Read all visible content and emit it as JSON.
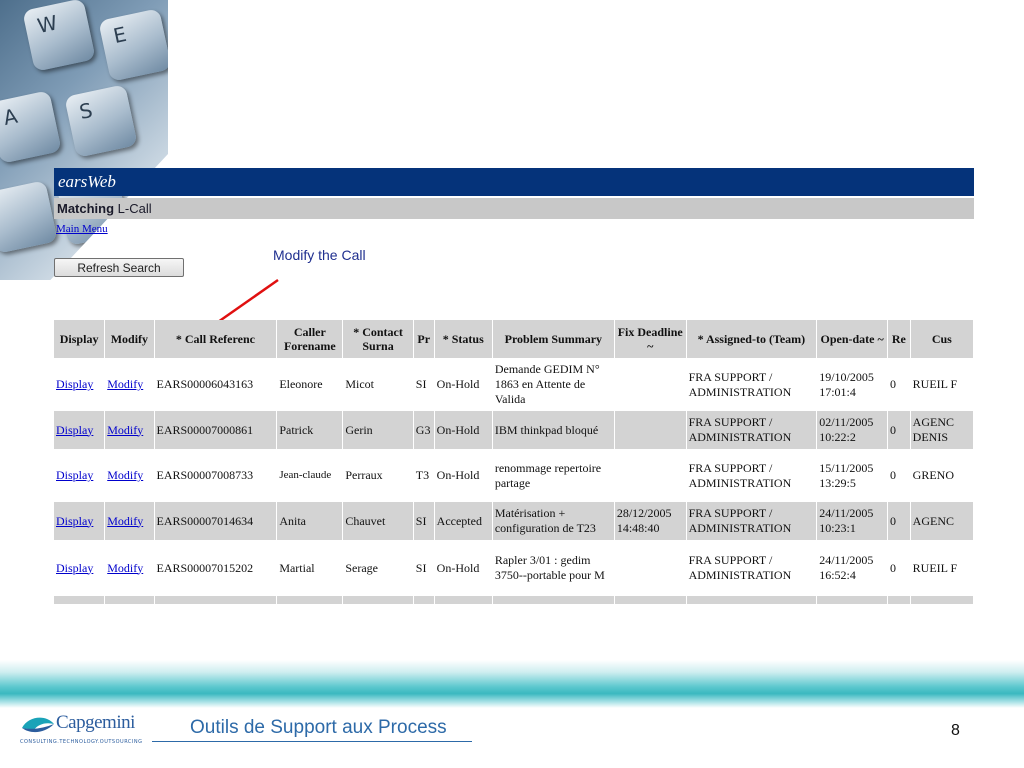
{
  "app": {
    "logo_text": "earsWeb",
    "subheader_bold": "Matching",
    "subheader_rest": " L-Call",
    "main_menu_link": "Main Menu",
    "refresh_button": "Refresh Search"
  },
  "annotation": {
    "label": "Modify the Call"
  },
  "keyboard_keys": [
    "W",
    "E",
    "A",
    "S"
  ],
  "table": {
    "headers": [
      "Display",
      "Modify",
      "* Call Referenc",
      "Caller Forename",
      "* Contact Surna",
      "Pr",
      "* Status",
      "Problem Summary",
      "Fix Deadline ~",
      "* Assigned-to (Team)",
      "Open-date ~",
      "Re",
      "Cus"
    ],
    "rows": [
      {
        "display": "Display",
        "modify": "Modify",
        "ref": "EARS00006043163",
        "forename": "Eleonore",
        "surname": "Micot",
        "pr": "SI",
        "status": "On-Hold",
        "summary": "Demande GEDIM N° 1863 en Attente de Valida",
        "deadline": "",
        "team": "FRA SUPPORT / ADMINISTRATION",
        "opendate": "19/10/2005 17:01:4",
        "re": "0",
        "cust": "RUEIL F"
      },
      {
        "display": "Display",
        "modify": "Modify",
        "ref": "EARS00007000861",
        "forename": "Patrick",
        "surname": "Gerin",
        "pr": "G3",
        "status": "On-Hold",
        "summary": "IBM thinkpad bloqué",
        "deadline": "",
        "team": "FRA SUPPORT / ADMINISTRATION",
        "opendate": "02/11/2005 10:22:2",
        "re": "0",
        "cust": "AGENC DENIS"
      },
      {
        "display": "Display",
        "modify": "Modify",
        "ref": "EARS00007008733",
        "forename": "Jean-claude",
        "surname": "Perraux",
        "pr": "T3",
        "status": "On-Hold",
        "summary": "renommage repertoire partage",
        "deadline": "",
        "team": "FRA SUPPORT / ADMINISTRATION",
        "opendate": "15/11/2005 13:29:5",
        "re": "0",
        "cust": "GRENO"
      },
      {
        "display": "Display",
        "modify": "Modify",
        "ref": "EARS00007014634",
        "forename": "Anita",
        "surname": "Chauvet",
        "pr": "SI",
        "status": "Accepted",
        "summary": "Matérisation + configuration de T23",
        "deadline": "28/12/2005 14:48:40",
        "team": "FRA SUPPORT / ADMINISTRATION",
        "opendate": "24/11/2005 10:23:1",
        "re": "0",
        "cust": "AGENC"
      },
      {
        "display": "Display",
        "modify": "Modify",
        "ref": "EARS00007015202",
        "forename": "Martial",
        "surname": "Serage",
        "pr": "SI",
        "status": "On-Hold",
        "summary": "Rapler 3/01 : gedim 3750--portable pour M",
        "deadline": "",
        "team": "FRA SUPPORT / ADMINISTRATION",
        "opendate": "24/11/2005 16:52:4",
        "re": "0",
        "cust": "RUEIL F"
      }
    ]
  },
  "footer": {
    "logo_word": "Capgemini",
    "logo_tagline": "CONSULTING.TECHNOLOGY.OUTSOURCING",
    "title": "Outils de Support aux Process",
    "page_number": "8"
  },
  "colors": {
    "header_blue": "#05337a",
    "subheader_gray": "#c8c8c8",
    "row_gray": "#d3d3d3",
    "link_blue": "#0000cc",
    "arrow_red": "#e01010",
    "footer_teal": "#3bb8c0"
  }
}
